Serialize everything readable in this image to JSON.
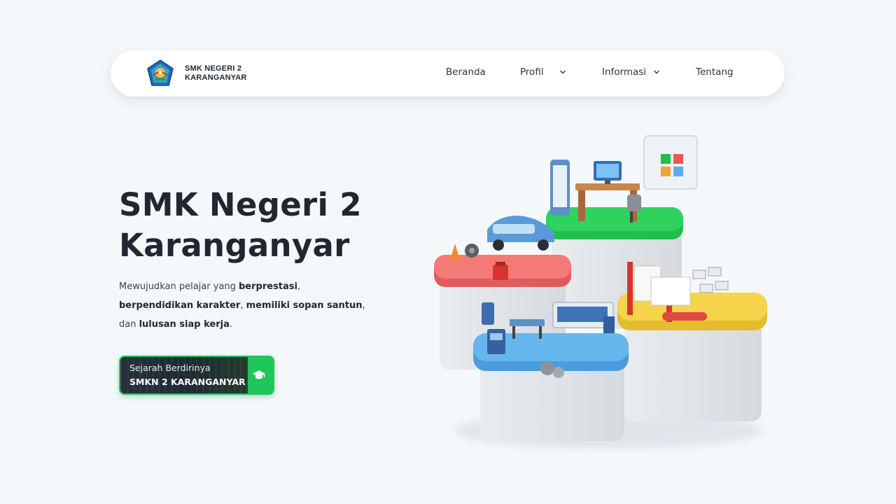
{
  "navbar": {
    "brand_line1": "SMK NEGERI 2",
    "brand_line2": "KARANGANYAR",
    "items": [
      {
        "label": "Beranda"
      },
      {
        "label": "Profil",
        "icon": "chevron-down-icon"
      },
      {
        "label": "Informasi",
        "icon": "chevron-down-icon"
      },
      {
        "label": "Tentang"
      }
    ]
  },
  "hero": {
    "title_line1": "SMK Negeri 2",
    "title_line2": "Karanganyar",
    "desc": {
      "p1": "Mewujudkan pelajar yang ",
      "b1": "berprestasi",
      "p2": ",",
      "b2": "berpendidikan karakter",
      "p3": ", ",
      "b3": "memiliki sopan santun",
      "p4": ",",
      "p5": "dan ",
      "b4": "lulusan siap kerja",
      "p6": "."
    },
    "cta": {
      "small": "Sejarah Berdirinya",
      "bold": "SMKN 2 KARANGANYAR",
      "icon": "graduation-cap-icon"
    }
  },
  "colors": {
    "accent_green": "#1fc65a",
    "red_block": "#f26d6d",
    "green_block": "#1fbf4a",
    "blue_block": "#5aaee8",
    "yellow_block": "#f4d24c"
  }
}
